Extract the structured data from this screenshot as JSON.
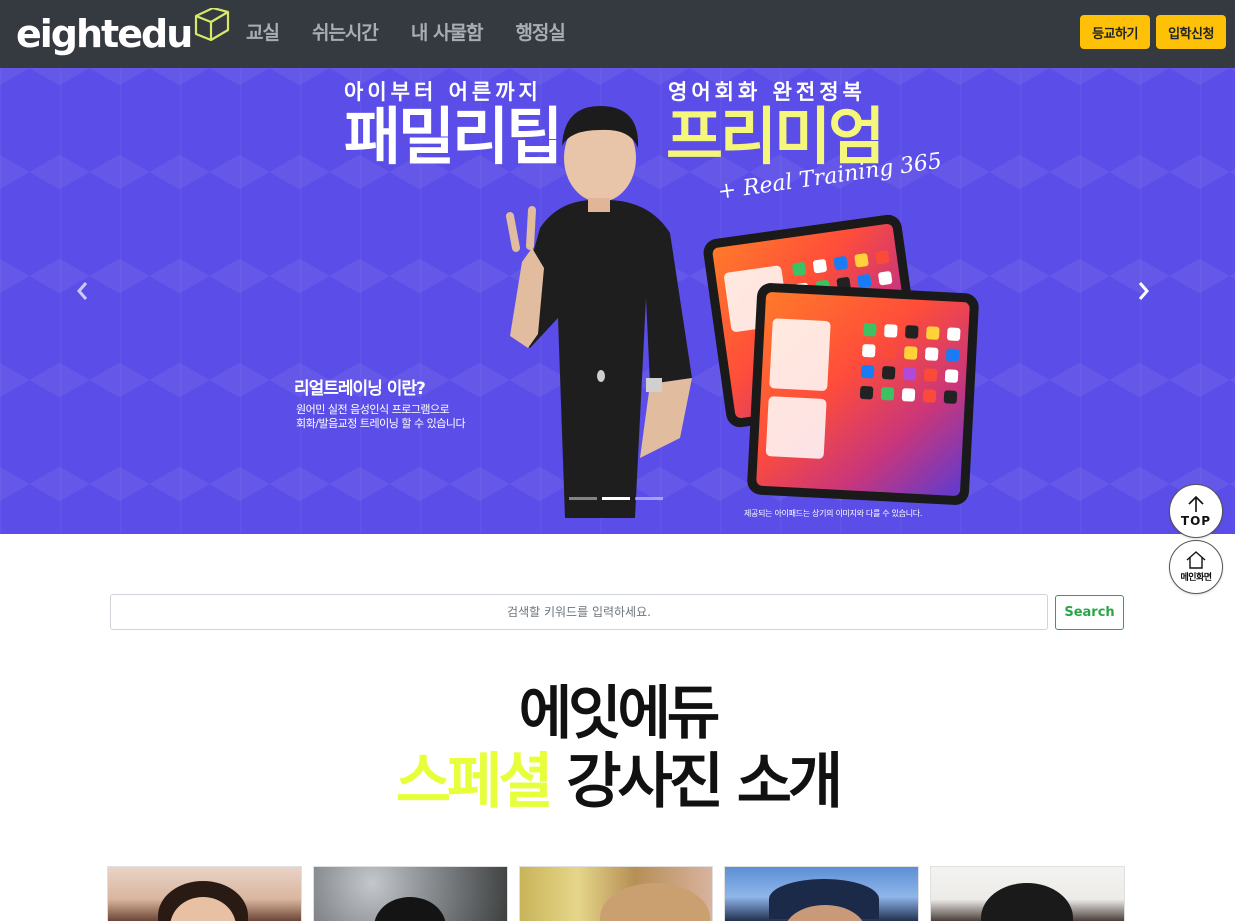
{
  "navbar": {
    "logo": "eightedu",
    "links": [
      "교실",
      "쉬는시간",
      "내 사물함",
      "행정실"
    ],
    "attend_button": "등교하기",
    "enroll_button": "입학신청"
  },
  "carousel": {
    "tag_left": "아이부터 어른까지",
    "title_left": "패밀리팁",
    "tag_right": "영어회화 완전정복",
    "title_right": "프리미엄",
    "script": "+ Real Training 365",
    "question": "리얼트레이닝 이란?",
    "desc_1": "원어민 실전 음성인식 프로그램으로",
    "desc_2": "회화/발음교정 트레이닝 할 수 있습니다",
    "note": "제공되는 아이패드는 상기의 이미지와 다를 수 있습니다.",
    "prev": "‹",
    "next": "›",
    "slide_count": 3,
    "active_slide": 2,
    "background_color": "#5b4ee8",
    "highlight_color": "#f5f77a"
  },
  "float": {
    "top_label": "TOP",
    "home_label": "메인화면"
  },
  "search": {
    "placeholder": "검색할 키워드를 입력하세요.",
    "button": "Search"
  },
  "section": {
    "title_line1": "에잇에듀",
    "title_highlight": "스페셜",
    "title_rest": " 강사진 소개",
    "highlight_color": "#e6ff3a"
  },
  "teachers": {
    "count": 5
  }
}
